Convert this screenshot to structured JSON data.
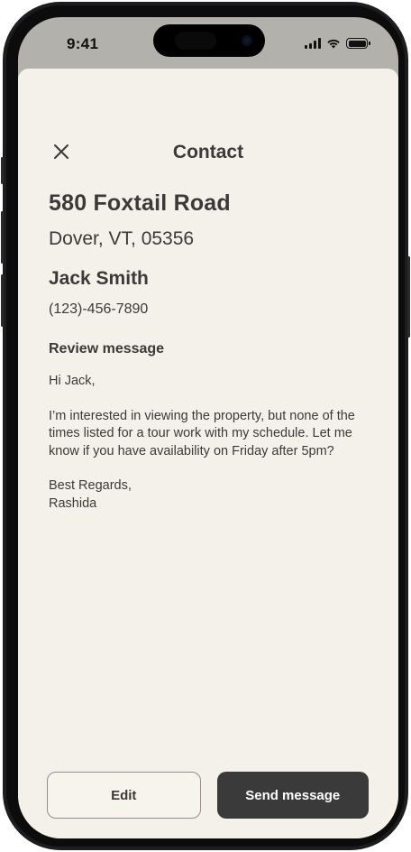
{
  "status_bar": {
    "time": "9:41",
    "signal_icon": "cellular-signal-icon",
    "wifi_icon": "wifi-icon",
    "battery_icon": "battery-icon"
  },
  "header": {
    "close_icon": "close-icon",
    "title": "Contact"
  },
  "property": {
    "address_line1": "580 Foxtail Road",
    "address_line2": "Dover, VT, 05356"
  },
  "contact": {
    "name": "Jack Smith",
    "phone": "(123)-456-7890"
  },
  "review": {
    "label": "Review message",
    "greeting": "Hi Jack,",
    "body": "I’m interested in viewing the property, but none of the times listed for a tour work with my schedule. Let me know if you have availability on Friday after 5pm?",
    "closing": "Best Regards,",
    "signature": "Rashida"
  },
  "actions": {
    "edit_label": "Edit",
    "send_label": "Send message"
  },
  "colors": {
    "background": "#f4f1ea",
    "text": "#3b3a38",
    "primary_button": "#3a3a3a",
    "secondary_border": "#9a8a8a"
  }
}
